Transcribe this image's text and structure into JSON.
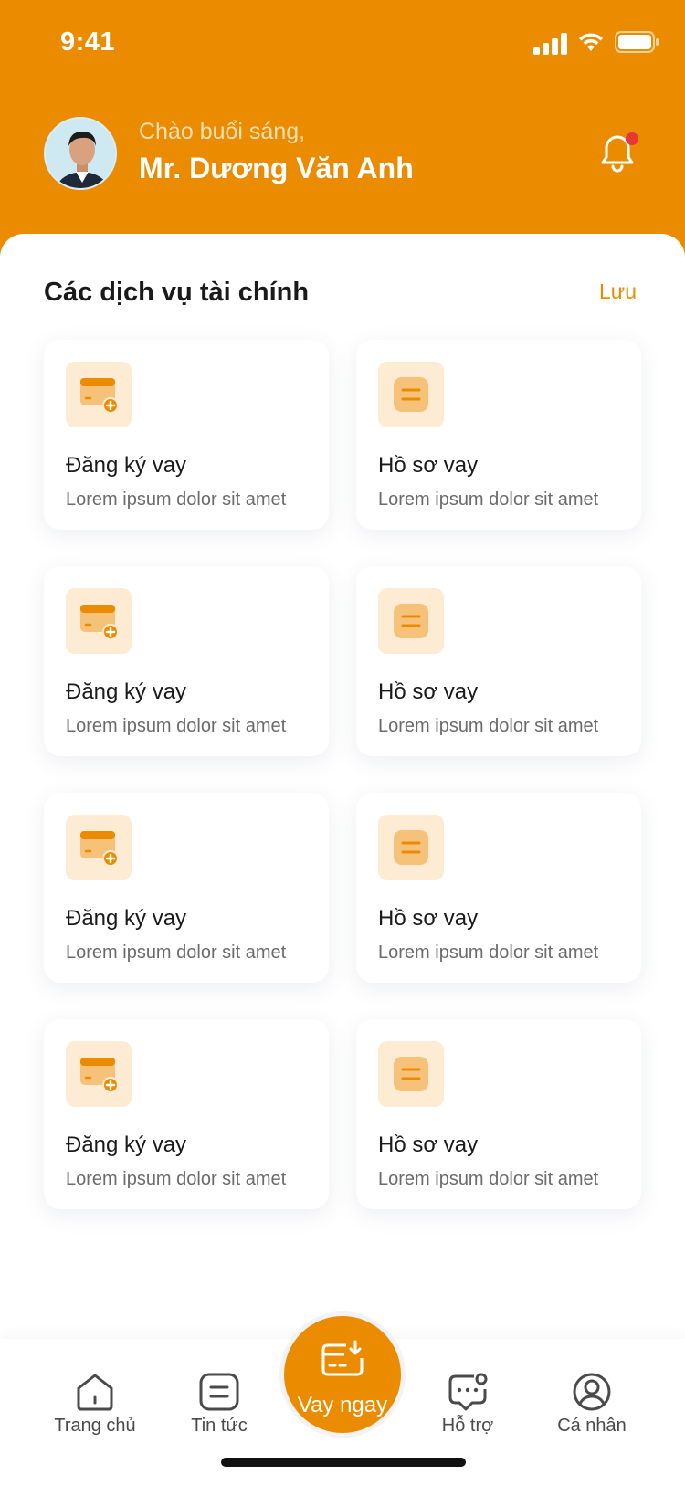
{
  "status_bar": {
    "time": "9:41"
  },
  "header": {
    "greeting": "Chào buổi sáng,",
    "user_name": "Mr. Dương Văn Anh",
    "notification_dot": true
  },
  "services": {
    "title": "Các dịch vụ tài chính",
    "save_label": "Lưu",
    "cards": [
      {
        "icon": "loan-register-icon",
        "title": "Đăng ký vay",
        "desc": "Lorem ipsum dolor sit amet"
      },
      {
        "icon": "loan-profile-icon",
        "title": "Hồ sơ vay",
        "desc": "Lorem ipsum dolor sit amet"
      },
      {
        "icon": "loan-register-icon",
        "title": "Đăng ký vay",
        "desc": "Lorem ipsum dolor sit amet"
      },
      {
        "icon": "loan-profile-icon",
        "title": "Hồ sơ vay",
        "desc": "Lorem ipsum dolor sit amet"
      },
      {
        "icon": "loan-register-icon",
        "title": "Đăng ký vay",
        "desc": "Lorem ipsum dolor sit amet"
      },
      {
        "icon": "loan-profile-icon",
        "title": "Hồ sơ vay",
        "desc": "Lorem ipsum dolor sit amet"
      },
      {
        "icon": "loan-register-icon",
        "title": "Đăng ký vay",
        "desc": "Lorem ipsum dolor sit amet"
      },
      {
        "icon": "loan-profile-icon",
        "title": "Hồ sơ vay",
        "desc": "Lorem ipsum dolor sit amet"
      }
    ]
  },
  "tabbar": {
    "home": "Trang chủ",
    "news": "Tin tức",
    "cta": "Vay ngay",
    "support": "Hỗ trợ",
    "profile": "Cá nhân"
  },
  "colors": {
    "brand": "#EB8C00",
    "icon_bg": "#FDEBD3",
    "icon_fill": "#F6C27A",
    "alert": "#E53935"
  }
}
